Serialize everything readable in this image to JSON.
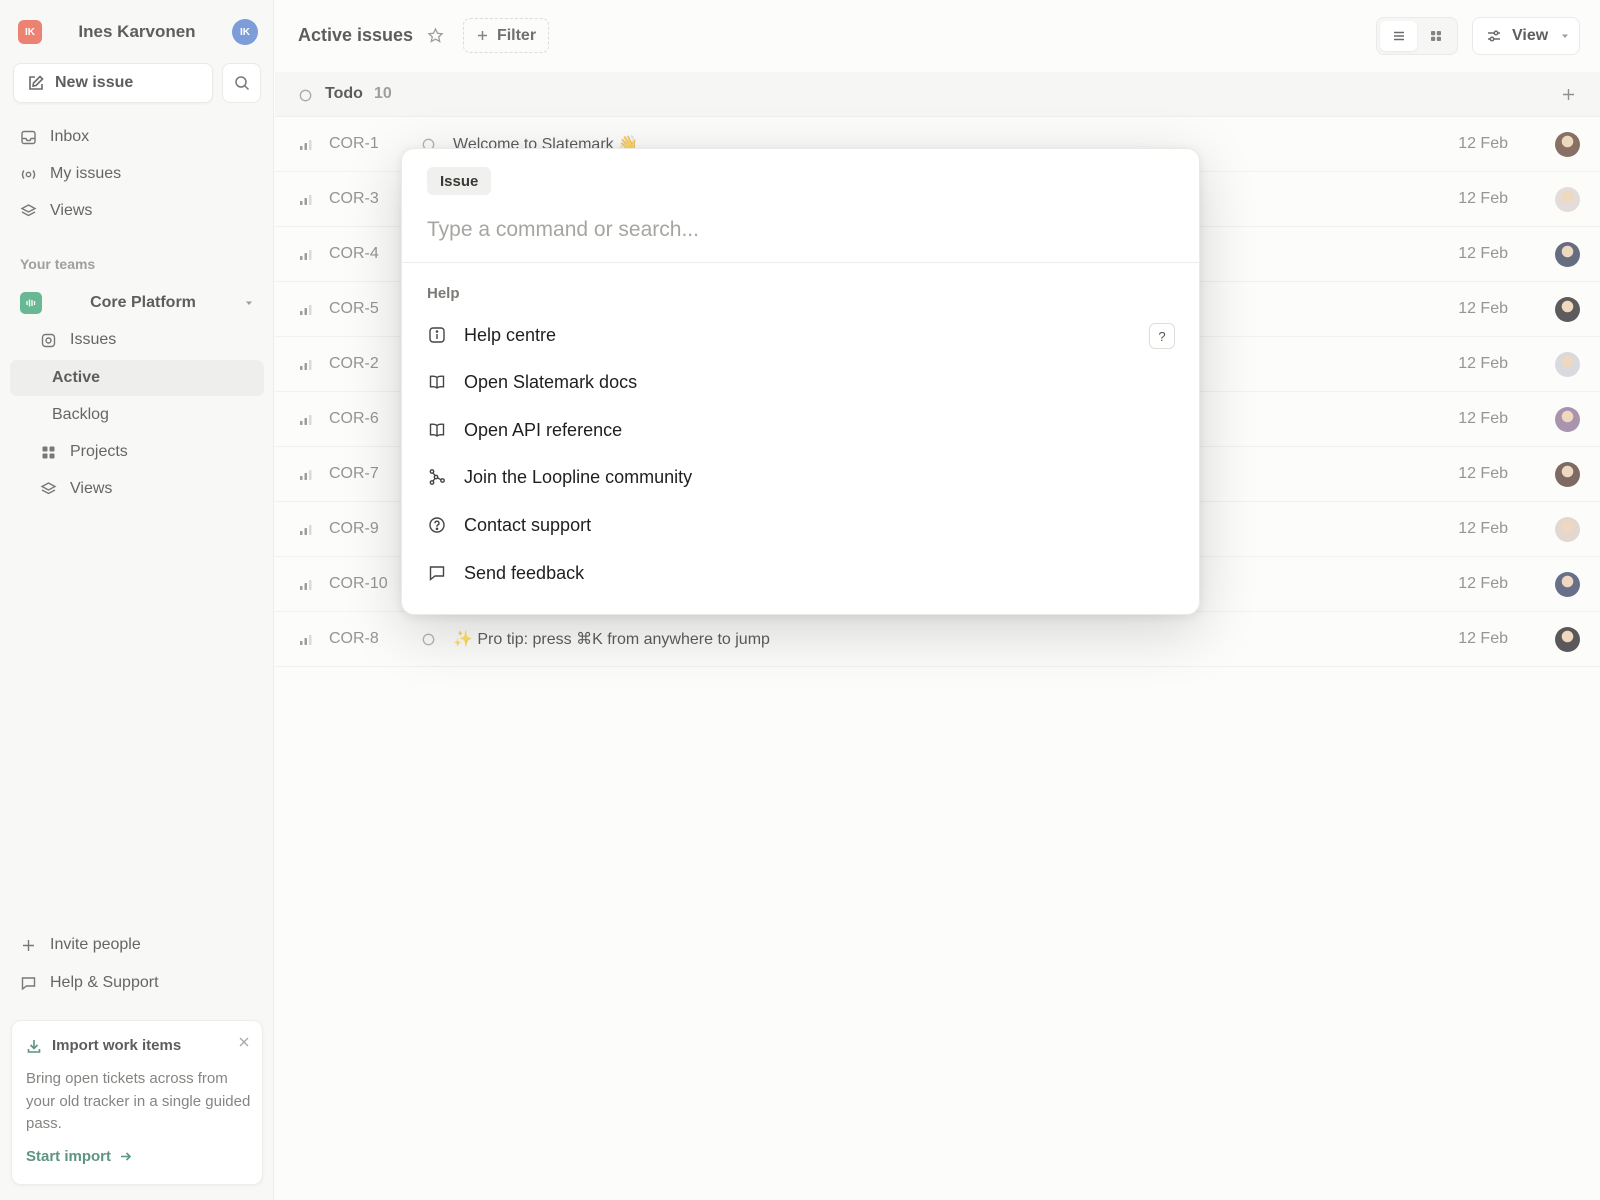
{
  "workspace": {
    "logo_initials": "IK",
    "user_name": "Ines Karvonen",
    "avatar_initials": "IK",
    "logo_color": "#e5533c",
    "avatar_color": "#4a78c9"
  },
  "sidebar": {
    "new_issue_label": "New issue",
    "nav": [
      {
        "label": "Inbox",
        "icon": "inbox-icon"
      },
      {
        "label": "My issues",
        "icon": "my-issues-icon"
      },
      {
        "label": "Views",
        "icon": "layers-icon"
      }
    ],
    "section_label": "Your teams",
    "team": {
      "name": "Core Platform",
      "color": "#2f9e6a",
      "items": [
        {
          "label": "Issues",
          "icon": "issues-icon"
        },
        {
          "label": "Active",
          "active": true
        },
        {
          "label": "Backlog"
        },
        {
          "label": "Projects",
          "icon": "grid-icon"
        },
        {
          "label": "Views",
          "icon": "layers-icon"
        }
      ]
    },
    "invite_label": "Invite people",
    "help_label": "Help & Support",
    "import_card": {
      "title": "Import work items",
      "description": "Bring open tickets across from your old tracker in a single guided pass.",
      "link": "Start import"
    }
  },
  "header": {
    "title": "Active issues",
    "filter_label": "Filter",
    "view_label": "View"
  },
  "group": {
    "label": "Todo",
    "count": "10"
  },
  "issues": [
    {
      "id": "COR-1",
      "title": "Welcome to Slatemark 👋",
      "date": "12 Feb",
      "avatar": "#5b3a2a"
    },
    {
      "id": "COR-3",
      "title": "",
      "date": "12 Feb",
      "avatar": "#d8cfc8"
    },
    {
      "id": "COR-4",
      "title": "",
      "date": "12 Feb",
      "avatar": "#2b3550"
    },
    {
      "id": "COR-5",
      "title": "",
      "date": "12 Feb",
      "avatar": "#1e1e1e"
    },
    {
      "id": "COR-2",
      "title": "",
      "date": "12 Feb",
      "avatar": "#c9ccd2"
    },
    {
      "id": "COR-6",
      "title": "",
      "date": "12 Feb",
      "avatar": "#8a6a8e"
    },
    {
      "id": "COR-7",
      "title": "",
      "date": "12 Feb",
      "avatar": "#4b3328"
    },
    {
      "id": "COR-9",
      "title": "",
      "date": "12 Feb",
      "avatar": "#d9c8bd"
    },
    {
      "id": "COR-10",
      "title": "",
      "date": "12 Feb",
      "avatar": "#2e3a5c"
    },
    {
      "id": "COR-8",
      "title": "✨ Pro tip: press ⌘K from anywhere to jump",
      "date": "12 Feb",
      "avatar": "#1a1a1a"
    }
  ],
  "palette": {
    "chip": "Issue",
    "placeholder": "Type a command or search...",
    "group_label": "Help",
    "items": [
      {
        "label": "Help centre",
        "icon": "info-icon",
        "shortcut": "?"
      },
      {
        "label": "Open Slatemark docs",
        "icon": "book-icon"
      },
      {
        "label": "Open API reference",
        "icon": "book-icon"
      },
      {
        "label": "Join the Loopline community",
        "icon": "community-icon"
      },
      {
        "label": "Contact support",
        "icon": "question-circle-icon"
      },
      {
        "label": "Send feedback",
        "icon": "chat-bubble-icon"
      }
    ]
  }
}
